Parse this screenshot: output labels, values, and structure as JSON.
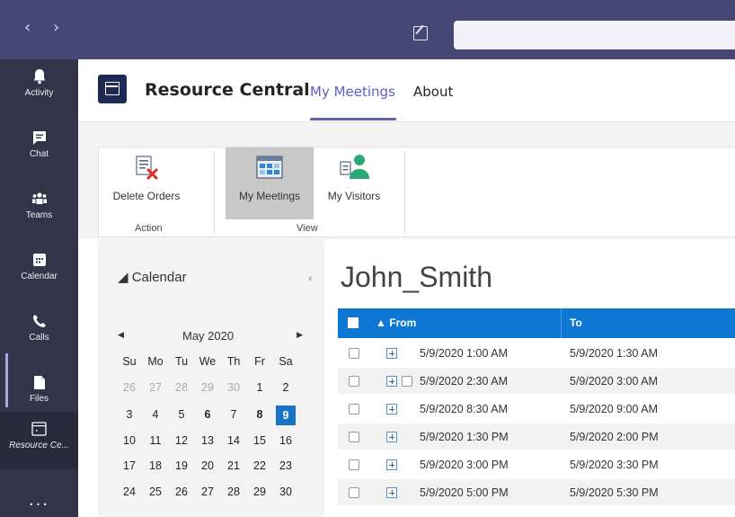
{
  "topbar": {
    "back_arrow": "‹",
    "forward_arrow": "›"
  },
  "rail": {
    "items": [
      {
        "label": "Activity",
        "icon": "bell-icon"
      },
      {
        "label": "Chat",
        "icon": "chat-icon"
      },
      {
        "label": "Teams",
        "icon": "teams-icon"
      },
      {
        "label": "Calendar",
        "icon": "calendar-icon"
      },
      {
        "label": "Calls",
        "icon": "phone-icon"
      },
      {
        "label": "Files",
        "icon": "file-icon"
      },
      {
        "label": "Resource Ce...",
        "icon": "resource-calendar-icon"
      }
    ],
    "more": "..."
  },
  "app": {
    "name": "Resource Central",
    "tabs": [
      {
        "label": "My Meetings"
      },
      {
        "label": "About"
      }
    ]
  },
  "ribbon": {
    "buttons": [
      {
        "label": "Delete Orders",
        "icon": "delete-orders-icon"
      },
      {
        "label": "My Meetings",
        "icon": "my-meetings-icon"
      },
      {
        "label": "My Visitors",
        "icon": "my-visitors-icon"
      }
    ],
    "groups": [
      {
        "label": "Action"
      },
      {
        "label": "View"
      }
    ]
  },
  "calendar": {
    "header": "Calendar",
    "month": "May 2020",
    "days_of_week": [
      "Su",
      "Mo",
      "Tu",
      "We",
      "Th",
      "Fr",
      "Sa"
    ],
    "weeks": [
      [
        "26",
        "27",
        "28",
        "29",
        "30",
        "1",
        "2"
      ],
      [
        "3",
        "4",
        "5",
        "6",
        "7",
        "8",
        "9"
      ],
      [
        "10",
        "11",
        "12",
        "13",
        "14",
        "15",
        "16"
      ],
      [
        "17",
        "18",
        "19",
        "20",
        "21",
        "22",
        "23"
      ],
      [
        "24",
        "25",
        "26",
        "27",
        "28",
        "29",
        "30"
      ]
    ],
    "selected_day": "9"
  },
  "main": {
    "title": "John_Smith",
    "columns": {
      "from": "From",
      "to": "To",
      "sort_indicator": "▲"
    },
    "rows": [
      {
        "from": "5/9/2020 1:00 AM",
        "to": "5/9/2020 1:30 AM"
      },
      {
        "from": "5/9/2020 2:30 AM",
        "to": "5/9/2020 3:00 AM"
      },
      {
        "from": "5/9/2020 8:30 AM",
        "to": "5/9/2020 9:00 AM"
      },
      {
        "from": "5/9/2020 1:30 PM",
        "to": "5/9/2020 2:00 PM"
      },
      {
        "from": "5/9/2020 3:00 PM",
        "to": "5/9/2020 3:30 PM"
      },
      {
        "from": "5/9/2020 5:00 PM",
        "to": "5/9/2020 5:30 PM"
      }
    ]
  }
}
